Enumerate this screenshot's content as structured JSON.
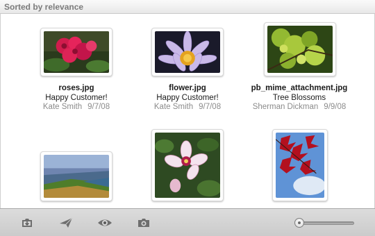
{
  "header": {
    "sort_label": "Sorted by relevance"
  },
  "items": [
    {
      "filename": "roses.jpg",
      "comment": "Happy Customer!",
      "author": "Kate Smith",
      "date": "9/7/08"
    },
    {
      "filename": "flower.jpg",
      "comment": "Happy Customer!",
      "author": "Kate Smith",
      "date": "9/7/08"
    },
    {
      "filename": "pb_mime_attachment.jpg",
      "comment": "Tree Blossoms",
      "author": "Sherman Dickman",
      "date": "9/9/08"
    },
    {
      "filename": "",
      "comment": "",
      "author": "",
      "date": ""
    },
    {
      "filename": "",
      "comment": "",
      "author": "",
      "date": ""
    },
    {
      "filename": "",
      "comment": "",
      "author": "",
      "date": ""
    }
  ],
  "toolbar": {
    "buttons": [
      "download-icon",
      "send-icon",
      "eye-icon",
      "camera-icon"
    ],
    "zoom_slider_level": 0.05
  },
  "colors": {
    "header_text": "#7b7b7b",
    "meta_text": "#8b8b8b",
    "toolbar_bg": "#d4d4d4"
  }
}
